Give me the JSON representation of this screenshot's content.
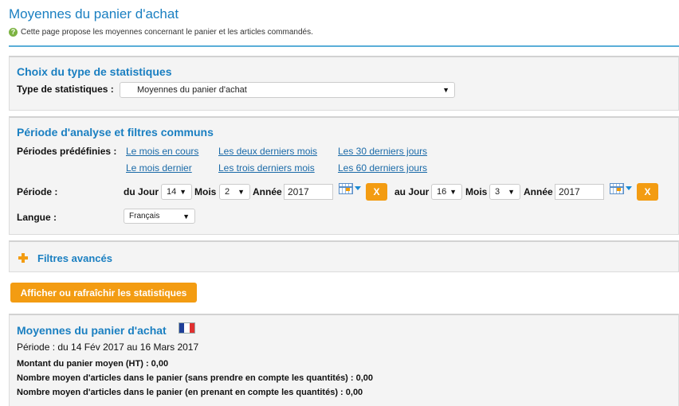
{
  "header": {
    "title": "Moyennes du panier d'achat",
    "intro": "Cette page propose les moyennes concernant le panier et les articles commandés."
  },
  "stats_type": {
    "title": "Choix du type de statistiques",
    "label": "Type de statistiques :",
    "selected": "Moyennes du panier d'achat"
  },
  "period": {
    "title": "Période d'analyse et filtres communs",
    "predefined_label": "Périodes prédéfinies :",
    "links": [
      "Le mois en cours",
      "Les deux derniers mois",
      "Les 30 derniers jours",
      "Le mois dernier",
      "Les trois derniers mois",
      "Les 60 derniers jours"
    ],
    "period_label": "Période :",
    "from": {
      "label": "du Jour",
      "day": "14",
      "month_label": "Mois",
      "month": "2",
      "year_label": "Année",
      "year": "2017"
    },
    "to": {
      "label": "au Jour",
      "day": "16",
      "month_label": "Mois",
      "month": "3",
      "year_label": "Année",
      "year": "2017"
    },
    "clear": "X",
    "language_label": "Langue :",
    "language": "Français"
  },
  "advanced": {
    "title": "Filtres avancés"
  },
  "refresh_button": "Afficher ou rafraîchir les statistiques",
  "results": {
    "title": "Moyennes du panier d'achat",
    "period": "Période : du 14 Fév 2017 au 16 Mars 2017",
    "lines": [
      "Montant du panier moyen (HT) : 0,00",
      "Nombre moyen d'articles dans le panier (sans prendre en compte les quantités) : 0,00",
      "Nombre moyen d'articles dans le panier (en prenant en compte les quantités) : 0,00"
    ],
    "flag_colors": [
      "#1f3f99",
      "#ffffff",
      "#e03030"
    ]
  },
  "colors": {
    "accent": "#1a7fc1",
    "button": "#f39c12",
    "link": "#1a6aa8"
  }
}
